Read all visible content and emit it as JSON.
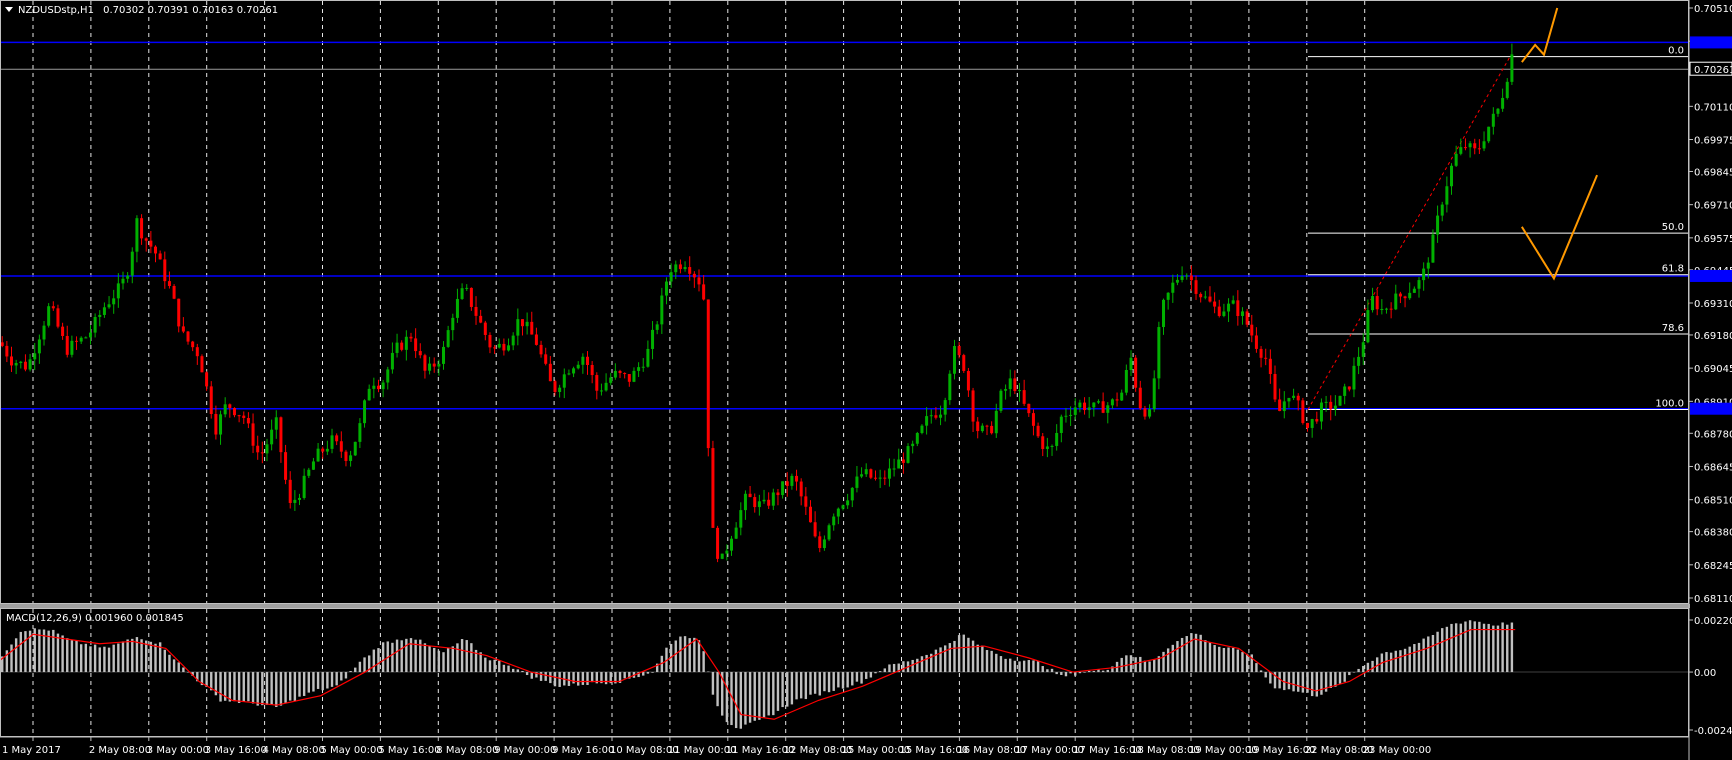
{
  "window": {
    "title": "NZDUSDstp,H1",
    "ohlc": "0.70302 0.70391 0.70163 0.70261"
  },
  "indicator": {
    "title": "MACD(12,26,9) 0.001960 0.001845"
  },
  "colors": {
    "background": "#000000",
    "bull": "#00b000",
    "bear": "#ff0000",
    "grid": "#ffffff",
    "level": "#0000ff",
    "fib": "#ffffff",
    "projection": "#ff9900",
    "macd_hist": "#c0c0c0",
    "macd_signal": "#ff0000"
  },
  "price_axis": {
    "labels": [
      "0.70510",
      "0.70375",
      "0.70261",
      "0.70110",
      "0.69975",
      "0.69845",
      "0.69710",
      "0.69575",
      "0.69445",
      "0.69310",
      "0.69180",
      "0.69045",
      "0.68910",
      "0.68780",
      "0.68645",
      "0.68510",
      "0.68380",
      "0.68245",
      "0.68110"
    ],
    "current_price": "0.70261"
  },
  "macd_axis": {
    "labels": [
      "0.002205",
      "0.00",
      "-0.002455"
    ]
  },
  "time_axis": {
    "labels": [
      "1 May 2017",
      "2 May 08:00",
      "3 May 00:00",
      "3 May 16:00",
      "4 May 08:00",
      "5 May 00:00",
      "5 May 16:00",
      "8 May 08:00",
      "9 May 00:00",
      "9 May 16:00",
      "10 May 08:00",
      "11 May 00:00",
      "11 May 16:00",
      "12 May 08:00",
      "15 May 00:00",
      "15 May 16:00",
      "16 May 08:00",
      "17 May 00:00",
      "17 May 16:00",
      "18 May 08:00",
      "19 May 00:00",
      "19 May 16:00",
      "22 May 08:00",
      "23 May 00:00"
    ]
  },
  "horizontal_levels": {
    "prices": [
      0.7037,
      0.6942,
      0.6888
    ]
  },
  "fibonacci": {
    "levels": [
      {
        "label": "0.0",
        "price": 0.70312
      },
      {
        "label": "50.0",
        "price": 0.69594
      },
      {
        "label": "61.8",
        "price": 0.69425
      },
      {
        "label": "78.6",
        "price": 0.69184
      },
      {
        "label": "100.0",
        "price": 0.68877
      }
    ]
  },
  "chart_data": {
    "type": "candlestick",
    "symbol": "NZDUSDstp",
    "timeframe": "H1",
    "ylim": [
      0.6811,
      0.7051
    ],
    "price_path": [
      [
        0,
        0.6915
      ],
      [
        10,
        0.6908
      ],
      [
        25,
        0.6905
      ],
      [
        45,
        0.693
      ],
      [
        60,
        0.6912
      ],
      [
        80,
        0.6918
      ],
      [
        95,
        0.693
      ],
      [
        110,
        0.6938
      ],
      [
        118,
        0.6948
      ],
      [
        123,
        0.6965
      ],
      [
        130,
        0.6958
      ],
      [
        140,
        0.6952
      ],
      [
        155,
        0.6935
      ],
      [
        165,
        0.6918
      ],
      [
        180,
        0.691
      ],
      [
        195,
        0.688
      ],
      [
        205,
        0.689
      ],
      [
        220,
        0.6885
      ],
      [
        235,
        0.6868
      ],
      [
        250,
        0.6882
      ],
      [
        262,
        0.6848
      ],
      [
        272,
        0.6855
      ],
      [
        285,
        0.6868
      ],
      [
        300,
        0.6875
      ],
      [
        315,
        0.6868
      ],
      [
        325,
        0.688
      ],
      [
        335,
        0.69
      ],
      [
        345,
        0.6898
      ],
      [
        358,
        0.6912
      ],
      [
        372,
        0.6918
      ],
      [
        385,
        0.6902
      ],
      [
        400,
        0.691
      ],
      [
        410,
        0.6928
      ],
      [
        420,
        0.6937
      ],
      [
        432,
        0.6925
      ],
      [
        445,
        0.6912
      ],
      [
        458,
        0.6915
      ],
      [
        470,
        0.6925
      ],
      [
        485,
        0.6915
      ],
      [
        500,
        0.6895
      ],
      [
        515,
        0.6905
      ],
      [
        528,
        0.691
      ],
      [
        540,
        0.6895
      ],
      [
        555,
        0.6902
      ],
      [
        570,
        0.69
      ],
      [
        585,
        0.691
      ],
      [
        595,
        0.6925
      ],
      [
        605,
        0.6945
      ],
      [
        620,
        0.6948
      ],
      [
        632,
        0.694
      ],
      [
        638,
        0.693
      ],
      [
        641,
        0.686
      ],
      [
        645,
        0.6835
      ],
      [
        652,
        0.6825
      ],
      [
        662,
        0.6838
      ],
      [
        675,
        0.6852
      ],
      [
        690,
        0.6848
      ],
      [
        705,
        0.6855
      ],
      [
        718,
        0.686
      ],
      [
        730,
        0.6845
      ],
      [
        740,
        0.683
      ],
      [
        752,
        0.6845
      ],
      [
        765,
        0.6852
      ],
      [
        780,
        0.6862
      ],
      [
        795,
        0.6858
      ],
      [
        810,
        0.6865
      ],
      [
        825,
        0.6872
      ],
      [
        840,
        0.6885
      ],
      [
        852,
        0.6888
      ],
      [
        862,
        0.6912
      ],
      [
        872,
        0.6905
      ],
      [
        882,
        0.688
      ],
      [
        895,
        0.6878
      ],
      [
        905,
        0.6893
      ],
      [
        915,
        0.69
      ],
      [
        925,
        0.689
      ],
      [
        940,
        0.6875
      ],
      [
        950,
        0.687
      ],
      [
        960,
        0.6885
      ],
      [
        975,
        0.689
      ],
      [
        990,
        0.6888
      ],
      [
        1005,
        0.689
      ],
      [
        1015,
        0.6895
      ],
      [
        1022,
        0.691
      ],
      [
        1030,
        0.689
      ],
      [
        1040,
        0.6885
      ],
      [
        1050,
        0.6928
      ],
      [
        1060,
        0.6938
      ],
      [
        1070,
        0.6945
      ],
      [
        1085,
        0.6935
      ],
      [
        1100,
        0.6928
      ],
      [
        1115,
        0.693
      ],
      [
        1125,
        0.6925
      ],
      [
        1135,
        0.6915
      ],
      [
        1145,
        0.6908
      ],
      [
        1155,
        0.6885
      ],
      [
        1165,
        0.6895
      ],
      [
        1175,
        0.6888
      ],
      [
        1182,
        0.688
      ],
      [
        1195,
        0.6888
      ],
      [
        1210,
        0.689
      ],
      [
        1220,
        0.6898
      ],
      [
        1232,
        0.6915
      ],
      [
        1240,
        0.6933
      ],
      [
        1250,
        0.6928
      ],
      [
        1260,
        0.6932
      ],
      [
        1270,
        0.6935
      ],
      [
        1285,
        0.694
      ],
      [
        1295,
        0.6955
      ],
      [
        1305,
        0.6975
      ],
      [
        1315,
        0.699
      ],
      [
        1325,
        0.6995
      ],
      [
        1335,
        0.6992
      ],
      [
        1345,
        0.7002
      ],
      [
        1355,
        0.701
      ],
      [
        1362,
        0.7022
      ],
      [
        1368,
        0.7034
      ],
      [
        1370,
        0.70261
      ]
    ],
    "projections": [
      [
        [
          1376,
          0.7029
        ],
        [
          1388,
          0.7036
        ],
        [
          1396,
          0.7032
        ],
        [
          1408,
          0.7051
        ]
      ],
      [
        [
          1376,
          0.6962
        ],
        [
          1405,
          0.6941
        ],
        [
          1444,
          0.6983
        ]
      ]
    ],
    "macd": {
      "ylim": [
        -0.002455,
        0.002205
      ],
      "hist_path": [
        [
          0,
          0.0006
        ],
        [
          20,
          0.0018
        ],
        [
          45,
          0.0018
        ],
        [
          65,
          0.0013
        ],
        [
          95,
          0.001
        ],
        [
          125,
          0.0015
        ],
        [
          145,
          0.0012
        ],
        [
          165,
          0.0002
        ],
        [
          180,
          -0.0004
        ],
        [
          200,
          -0.0012
        ],
        [
          225,
          -0.0013
        ],
        [
          250,
          -0.0015
        ],
        [
          265,
          -0.0012
        ],
        [
          285,
          -0.0008
        ],
        [
          305,
          -0.0006
        ],
        [
          325,
          0.0004
        ],
        [
          345,
          0.0012
        ],
        [
          372,
          0.0015
        ],
        [
          400,
          0.0008
        ],
        [
          420,
          0.0014
        ],
        [
          440,
          0.0006
        ],
        [
          460,
          0.0003
        ],
        [
          480,
          -0.0002
        ],
        [
          505,
          -0.0006
        ],
        [
          530,
          -0.0005
        ],
        [
          560,
          -0.0004
        ],
        [
          590,
          0.0
        ],
        [
          605,
          0.0012
        ],
        [
          620,
          0.0016
        ],
        [
          635,
          0.0012
        ],
        [
          645,
          -0.001
        ],
        [
          655,
          -0.002
        ],
        [
          668,
          -0.0024
        ],
        [
          690,
          -0.002
        ],
        [
          720,
          -0.0012
        ],
        [
          750,
          -0.0008
        ],
        [
          780,
          -0.0004
        ],
        [
          800,
          0.0002
        ],
        [
          830,
          0.0006
        ],
        [
          850,
          0.001
        ],
        [
          870,
          0.0016
        ],
        [
          890,
          0.001
        ],
        [
          910,
          0.0006
        ],
        [
          940,
          0.0004
        ],
        [
          960,
          -0.0002
        ],
        [
          980,
          0.0
        ],
        [
          1000,
          0.0001
        ],
        [
          1020,
          0.0008
        ],
        [
          1040,
          0.0004
        ],
        [
          1060,
          0.0012
        ],
        [
          1080,
          0.0017
        ],
        [
          1100,
          0.0011
        ],
        [
          1130,
          0.0008
        ],
        [
          1150,
          -0.0006
        ],
        [
          1170,
          -0.0008
        ],
        [
          1190,
          -0.001
        ],
        [
          1210,
          -0.0006
        ],
        [
          1230,
          0.0002
        ],
        [
          1250,
          0.0008
        ],
        [
          1270,
          0.001
        ],
        [
          1290,
          0.0014
        ],
        [
          1310,
          0.002
        ],
        [
          1330,
          0.0022
        ],
        [
          1350,
          0.002
        ],
        [
          1370,
          0.0021
        ]
      ],
      "signal_path": [
        [
          0,
          0.0005
        ],
        [
          30,
          0.0016
        ],
        [
          60,
          0.0014
        ],
        [
          90,
          0.0012
        ],
        [
          120,
          0.0013
        ],
        [
          150,
          0.001
        ],
        [
          180,
          -0.0004
        ],
        [
          210,
          -0.0012
        ],
        [
          250,
          -0.0014
        ],
        [
          290,
          -0.001
        ],
        [
          330,
          0.0
        ],
        [
          370,
          0.0012
        ],
        [
          410,
          0.001
        ],
        [
          440,
          0.0007
        ],
        [
          480,
          0.0
        ],
        [
          520,
          -0.0004
        ],
        [
          560,
          -0.0004
        ],
        [
          600,
          0.0004
        ],
        [
          630,
          0.0014
        ],
        [
          650,
          0.0
        ],
        [
          670,
          -0.0018
        ],
        [
          700,
          -0.002
        ],
        [
          740,
          -0.0012
        ],
        [
          780,
          -0.0006
        ],
        [
          820,
          0.0002
        ],
        [
          860,
          0.001
        ],
        [
          890,
          0.0011
        ],
        [
          930,
          0.0006
        ],
        [
          970,
          0.0
        ],
        [
          1010,
          0.0002
        ],
        [
          1050,
          0.0006
        ],
        [
          1080,
          0.0014
        ],
        [
          1120,
          0.001
        ],
        [
          1160,
          -0.0004
        ],
        [
          1190,
          -0.0008
        ],
        [
          1220,
          -0.0004
        ],
        [
          1250,
          0.0004
        ],
        [
          1290,
          0.001
        ],
        [
          1330,
          0.0018
        ],
        [
          1370,
          0.0018
        ]
      ]
    }
  }
}
